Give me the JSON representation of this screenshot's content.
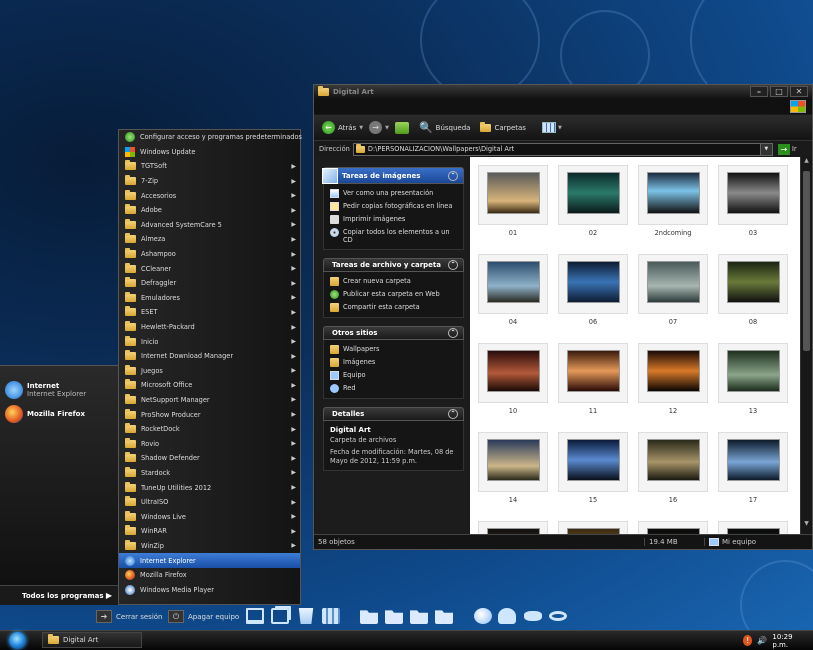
{
  "start_menu": {
    "pinned": [
      {
        "title": "Internet",
        "subtitle": "Internet Explorer",
        "icon": "internet-explorer-icon"
      },
      {
        "title": "Mozilla Firefox",
        "subtitle": "",
        "icon": "firefox-icon"
      }
    ],
    "all_programs_label": "Todos los programas",
    "programs": [
      {
        "label": "Configurar acceso y programas predeterminados",
        "icon": "default-programs-icon",
        "submenu": false
      },
      {
        "label": "Windows Update",
        "icon": "windows-update-icon",
        "submenu": false
      },
      {
        "label": "TGTSoft",
        "icon": "folder-icon",
        "submenu": true
      },
      {
        "label": "7-Zip",
        "icon": "folder-icon",
        "submenu": true
      },
      {
        "label": "Accesorios",
        "icon": "folder-icon",
        "submenu": true
      },
      {
        "label": "Adobe",
        "icon": "folder-icon",
        "submenu": true
      },
      {
        "label": "Advanced SystemCare 5",
        "icon": "folder-icon",
        "submenu": true
      },
      {
        "label": "Almeza",
        "icon": "folder-icon",
        "submenu": true
      },
      {
        "label": "Ashampoo",
        "icon": "folder-icon",
        "submenu": true
      },
      {
        "label": "CCleaner",
        "icon": "folder-icon",
        "submenu": true
      },
      {
        "label": "Defraggler",
        "icon": "folder-icon",
        "submenu": true
      },
      {
        "label": "Emuladores",
        "icon": "folder-icon",
        "submenu": true
      },
      {
        "label": "ESET",
        "icon": "folder-icon",
        "submenu": true
      },
      {
        "label": "Hewlett-Packard",
        "icon": "folder-icon",
        "submenu": true
      },
      {
        "label": "Inicio",
        "icon": "folder-icon",
        "submenu": true
      },
      {
        "label": "Internet Download Manager",
        "icon": "folder-icon",
        "submenu": true
      },
      {
        "label": "Juegos",
        "icon": "folder-icon",
        "submenu": true
      },
      {
        "label": "Microsoft Office",
        "icon": "folder-icon",
        "submenu": true
      },
      {
        "label": "NetSupport Manager",
        "icon": "folder-icon",
        "submenu": true
      },
      {
        "label": "ProShow Producer",
        "icon": "folder-icon",
        "submenu": true
      },
      {
        "label": "RocketDock",
        "icon": "folder-icon",
        "submenu": true
      },
      {
        "label": "Rovio",
        "icon": "folder-icon",
        "submenu": true
      },
      {
        "label": "Shadow Defender",
        "icon": "folder-icon",
        "submenu": true
      },
      {
        "label": "Stardock",
        "icon": "folder-icon",
        "submenu": true
      },
      {
        "label": "TuneUp Utilities 2012",
        "icon": "folder-icon",
        "submenu": true
      },
      {
        "label": "UltraISO",
        "icon": "folder-icon",
        "submenu": true
      },
      {
        "label": "Windows Live",
        "icon": "folder-icon",
        "submenu": true
      },
      {
        "label": "WinRAR",
        "icon": "folder-icon",
        "submenu": true
      },
      {
        "label": "WinZip",
        "icon": "folder-icon",
        "submenu": true
      },
      {
        "label": "Internet Explorer",
        "icon": "internet-explorer-icon",
        "submenu": false,
        "selected": true
      },
      {
        "label": "Mozilla Firefox",
        "icon": "firefox-icon",
        "submenu": false
      },
      {
        "label": "Windows Media Player",
        "icon": "media-player-icon",
        "submenu": false
      }
    ],
    "logoff_label": "Cerrar sesión",
    "shutdown_label": "Apagar equipo"
  },
  "dock_icons": [
    "computer-icon",
    "windows-icon",
    "trash-icon",
    "calculator-icon",
    "folder-icon",
    "music-folder-icon",
    "pictures-folder-icon",
    "documents-folder-icon",
    "firefox-icon",
    "messenger-icon",
    "gamepad-icon",
    "eye-icon"
  ],
  "taskbar": {
    "task_label": "Digital Art",
    "clock": "10:29 p.m."
  },
  "explorer": {
    "title": "Digital Art",
    "toolbar": {
      "back_label": "Atrás",
      "search_label": "Búsqueda",
      "folders_label": "Carpetas"
    },
    "address_label": "Dirección",
    "address_value": "D:\\PERSONALIZACION\\Wallpapers\\Digital Art",
    "go_label": "Ir",
    "image_tasks": {
      "header": "Tareas de imágenes",
      "items": [
        "Ver como una presentación",
        "Pedir copias fotográficas en línea",
        "Imprimir imágenes",
        "Copiar todos los elementos a un CD"
      ]
    },
    "file_tasks": {
      "header": "Tareas de archivo y carpeta",
      "items": [
        "Crear nueva carpeta",
        "Publicar esta carpeta en Web",
        "Compartir esta carpeta"
      ]
    },
    "other_places": {
      "header": "Otros sitios",
      "items": [
        "Wallpapers",
        "Imágenes",
        "Equipo",
        "Red"
      ]
    },
    "details": {
      "header": "Detalles",
      "name": "Digital Art",
      "type": "Carpeta de archivos",
      "modified": "Fecha de modificación: Martes, 08 de Mayo de 2012, 11:59 p.m."
    },
    "thumbnails": [
      "01",
      "02",
      "2ndcoming",
      "03",
      "04",
      "06",
      "07",
      "08",
      "10",
      "11",
      "12",
      "13",
      "14",
      "15",
      "16",
      "17",
      "",
      "",
      "",
      ""
    ],
    "status": {
      "count": "58 objetos",
      "size": "19.4 MB",
      "location": "Mi equipo"
    }
  }
}
